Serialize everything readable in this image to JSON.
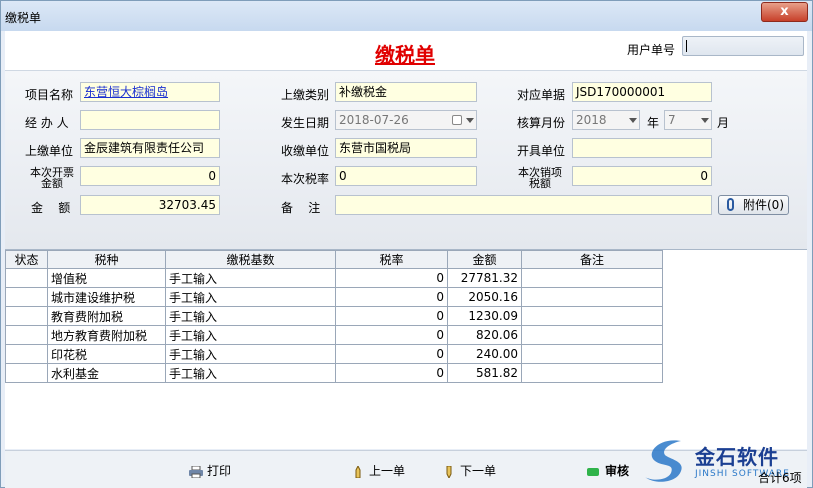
{
  "window": {
    "title": "缴税单",
    "close_label": "x"
  },
  "header": {
    "doc_title": "缴税单",
    "user_no_label": "用户单号",
    "user_no_value": ""
  },
  "form": {
    "project_name": {
      "label": "项目名称",
      "value": "东营恒大棕榈岛"
    },
    "pay_type": {
      "label": "上缴类别",
      "value": "补缴税金"
    },
    "ref_doc": {
      "label": "对应单据",
      "value": "JSD170000001"
    },
    "handler": {
      "label": "经 办 人",
      "value": ""
    },
    "date": {
      "label": "发生日期",
      "value": "2018-07-26"
    },
    "period": {
      "label": "核算月份",
      "year": "2018",
      "year_unit": "年",
      "month": "7",
      "month_unit": "月"
    },
    "pay_unit": {
      "label": "上缴单位",
      "value": "金辰建筑有限责任公司"
    },
    "recv_unit": {
      "label": "收缴单位",
      "value": "东营市国税局"
    },
    "issue_unit": {
      "label": "开具单位",
      "value": ""
    },
    "invoice_amount": {
      "label_line1": "本次开票",
      "label_line2": "金额",
      "value": "0"
    },
    "tax_rate": {
      "label": "本次税率",
      "value": "0"
    },
    "output_tax": {
      "label_line1": "本次销项",
      "label_line2": "税额",
      "value": "0"
    },
    "amount": {
      "label": "金    额",
      "value": "32703.45"
    },
    "remark": {
      "label": "备    注",
      "value": ""
    },
    "attach_label": "附件(0)"
  },
  "table": {
    "headers": [
      "状态",
      "税种",
      "缴税基数",
      "税率",
      "金额",
      "备注"
    ],
    "rows": [
      {
        "status": "",
        "tax": "增值税",
        "base": "手工输入",
        "rate": "0",
        "amount": "27781.32",
        "note": ""
      },
      {
        "status": "",
        "tax": "城市建设维护税",
        "base": "手工输入",
        "rate": "0",
        "amount": "2050.16",
        "note": ""
      },
      {
        "status": "",
        "tax": "教育费附加税",
        "base": "手工输入",
        "rate": "0",
        "amount": "1230.09",
        "note": ""
      },
      {
        "status": "",
        "tax": "地方教育费附加税",
        "base": "手工输入",
        "rate": "0",
        "amount": "820.06",
        "note": ""
      },
      {
        "status": "",
        "tax": "印花税",
        "base": "手工输入",
        "rate": "0",
        "amount": "240.00",
        "note": ""
      },
      {
        "status": "",
        "tax": "水利基金",
        "base": "手工输入",
        "rate": "0",
        "amount": "581.82",
        "note": ""
      }
    ]
  },
  "footer": {
    "print": "打印",
    "prev": "上一单",
    "next": "下一单",
    "audit": "审核",
    "summary": "合计6项"
  },
  "logo": {
    "name": "金石软件",
    "sub": "JINSHI SOFTWARE"
  },
  "colors": {
    "title_red": "#e00000",
    "field_yellow": "#ffffe1",
    "link_blue": "#1a2fd0"
  }
}
